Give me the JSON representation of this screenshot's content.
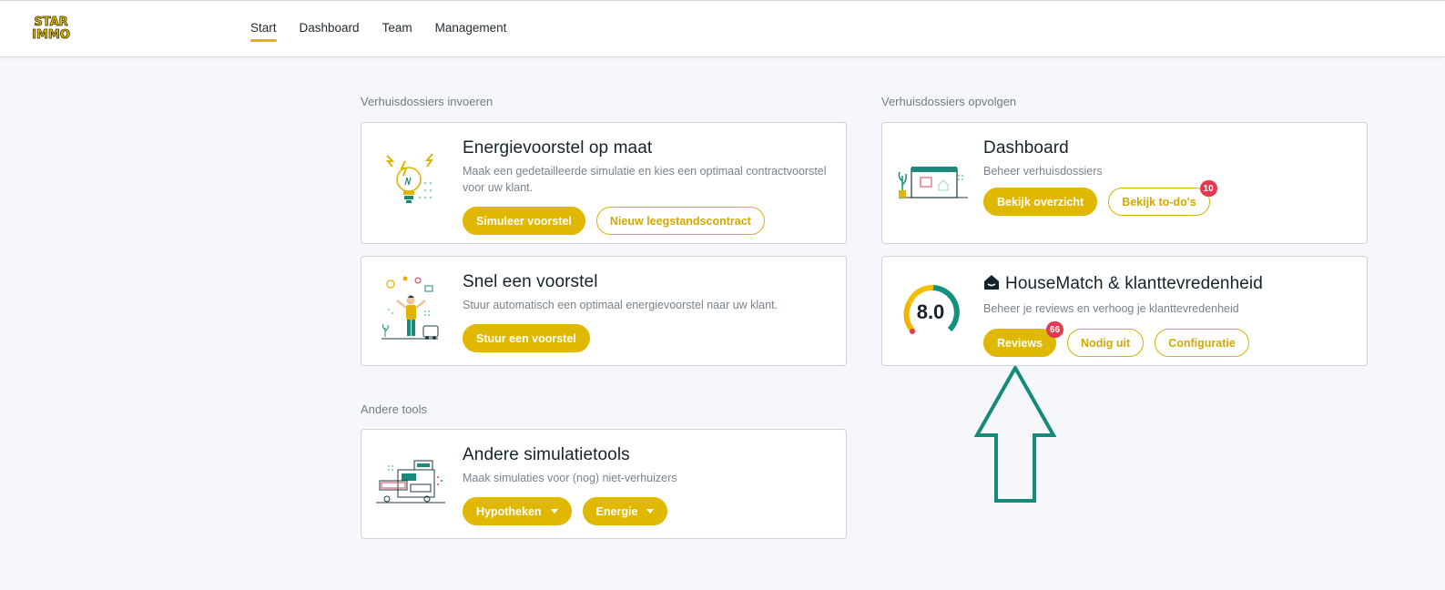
{
  "brand": {
    "logo_line1": "STAR",
    "logo_line2": "IMMO"
  },
  "nav": {
    "items": [
      "Start",
      "Dashboard",
      "Team",
      "Management"
    ],
    "active": "Start"
  },
  "sections": {
    "left_title": "Verhuisdossiers invoeren",
    "right_title": "Verhuisdossiers opvolgen",
    "other_title": "Andere tools"
  },
  "cards": {
    "energie": {
      "title": "Energievoorstel op maat",
      "description": "Maak een gedetailleerde simulatie en kies een optimaal contractvoorstel voor uw klant.",
      "btn_primary": "Simuleer voorstel",
      "btn_secondary": "Nieuw leegstandscontract"
    },
    "snel": {
      "title": "Snel een voorstel",
      "description": "Stuur automatisch een optimaal energievoorstel naar uw klant.",
      "btn_primary": "Stuur een voorstel"
    },
    "dashboard": {
      "title": "Dashboard",
      "description": "Beheer verhuisdossiers",
      "btn_primary": "Bekijk overzicht",
      "btn_secondary": "Bekijk to-do's",
      "todo_badge": "10"
    },
    "housematch": {
      "title": "HouseMatch & klanttevredenheid",
      "description": "Beheer je reviews en verhoog je klanttevredenheid",
      "score": "8.0",
      "score_fraction": 0.8,
      "btn_reviews": "Reviews",
      "reviews_badge": "66",
      "btn_invite": "Nodig uit",
      "btn_config": "Configuratie"
    },
    "andere": {
      "title": "Andere simulatietools",
      "description": "Maak simulaties voor (nog) niet-verhuizers",
      "btn_hypotheken": "Hypotheken",
      "btn_energie": "Energie"
    }
  },
  "colors": {
    "accent": "#e0b800",
    "badge": "#e53950",
    "arrow": "#138a7a",
    "gauge_green": "#14907e"
  }
}
